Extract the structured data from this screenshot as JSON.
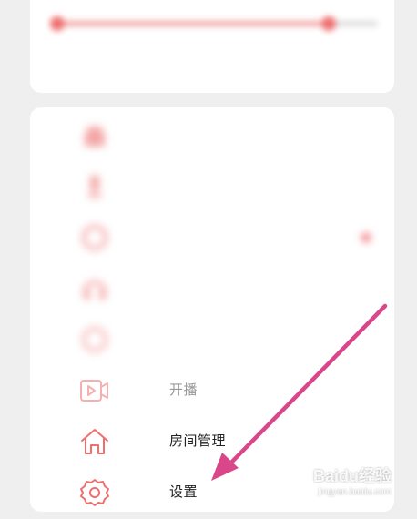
{
  "top_card": {
    "progress_fraction": 0.85,
    "left_label": "",
    "right_label": ""
  },
  "menu": {
    "items": [
      {
        "id": "item1",
        "label": "",
        "icon": "gift-icon",
        "blurred": true
      },
      {
        "id": "item2",
        "label": "",
        "icon": "microphone-icon",
        "right_text": "",
        "blurred": true
      },
      {
        "id": "item3",
        "label": "",
        "icon": "smile-icon",
        "has_dot": true,
        "blurred": true
      },
      {
        "id": "item4",
        "label": "",
        "icon": "headphones-icon",
        "blurred": true
      },
      {
        "id": "item5",
        "label": "",
        "icon": "clock-icon",
        "blurred": true
      },
      {
        "id": "item6",
        "label": "开播",
        "icon": "video-icon",
        "faded": true
      },
      {
        "id": "item7",
        "label": "房间管理",
        "icon": "home-icon"
      },
      {
        "id": "item8",
        "label": "设置",
        "icon": "gear-icon"
      }
    ]
  },
  "colors": {
    "icon_accent": "#ef6f6f",
    "arrow": "#d9478a",
    "background": "#efefef"
  },
  "watermark": {
    "main": "Bai⁠du经验",
    "sub": "jingyan.baidu.com"
  }
}
